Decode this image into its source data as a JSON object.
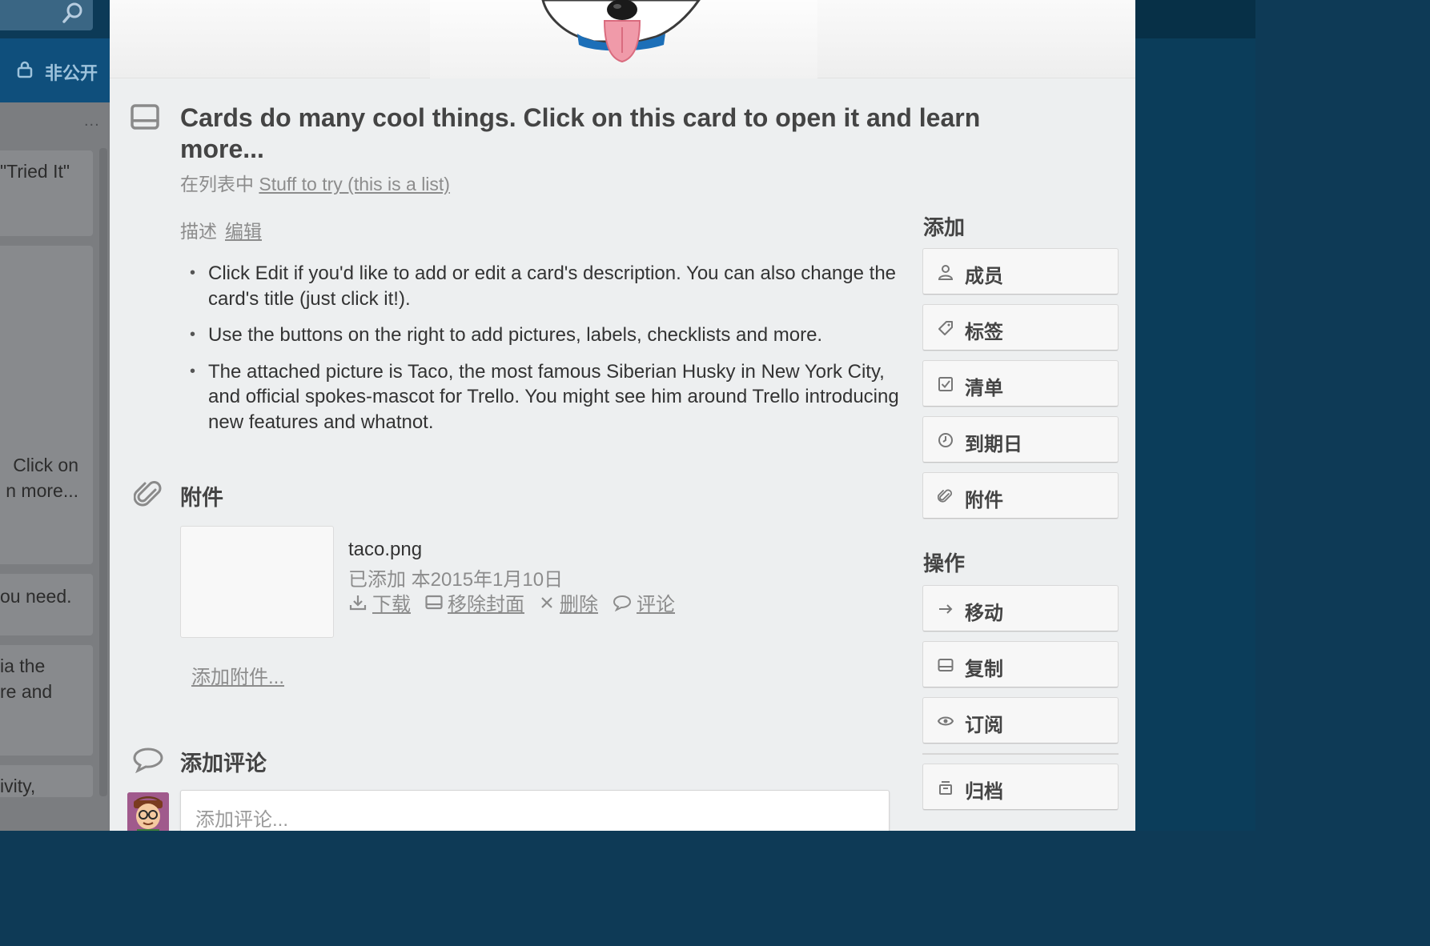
{
  "board": {
    "visibility_label": "非公开",
    "list_menu": "...",
    "mini_cards": [
      {
        "lines": [
          "\"Tried It\""
        ]
      },
      {
        "lines": [
          " Click on",
          "n more..."
        ]
      },
      {
        "lines": [
          "ou need."
        ]
      },
      {
        "lines": [
          "ia the",
          "re and"
        ]
      },
      {
        "lines": [
          "ivity,"
        ]
      }
    ]
  },
  "card": {
    "title": "Cards do many cool things. Click on this card to open it and learn more...",
    "in_list_prefix": "在列表中",
    "list_name": "Stuff to try (this is a list)",
    "description_label": "描述",
    "edit_link": "编辑",
    "description_items": [
      "Click Edit if you'd like to add or edit a card's description. You can also change the card's title (just click it!).",
      "Use the buttons on the right to add pictures, labels, checklists and more.",
      "The attached picture is Taco, the most famous Siberian Husky in New York City, and official spokes-mascot for Trello. You might see him around Trello introducing new features and whatnot."
    ],
    "attachments_label": "附件",
    "attachment": {
      "filename": "taco.png",
      "added": "已添加 本2015年1月10日",
      "actions": {
        "download": "下载",
        "remove_cover": "移除封面",
        "delete": "删除",
        "comment": "评论"
      }
    },
    "add_attachment": "添加附件...",
    "add_comment_label": "添加评论",
    "comment_placeholder": "添加评论..."
  },
  "sidebar": {
    "add_heading": "添加",
    "add_buttons": [
      "成员",
      "标签",
      "清单",
      "到期日",
      "附件"
    ],
    "actions_heading": "操作",
    "action_buttons": [
      "移动",
      "复制",
      "订阅"
    ],
    "archive_button": "归档"
  },
  "icons": {
    "search": "search-icon",
    "lock": "lock-icon",
    "card": "card-icon",
    "paperclip": "paperclip-icon",
    "comment": "comment-icon",
    "member": "person-icon",
    "label": "tag-icon",
    "checklist": "checkbox-icon",
    "due": "clock-icon",
    "move": "arrow-right-icon",
    "copy": "card-icon",
    "subscribe": "eye-icon",
    "archive": "archive-icon"
  },
  "colors": {
    "board_background": "#0e3a56",
    "modal_background": "#edeff0",
    "board_nav_blue": "#0f4f7c",
    "collar_blue": "#1c6fb8",
    "tongue_pink": "#f09aa9"
  }
}
